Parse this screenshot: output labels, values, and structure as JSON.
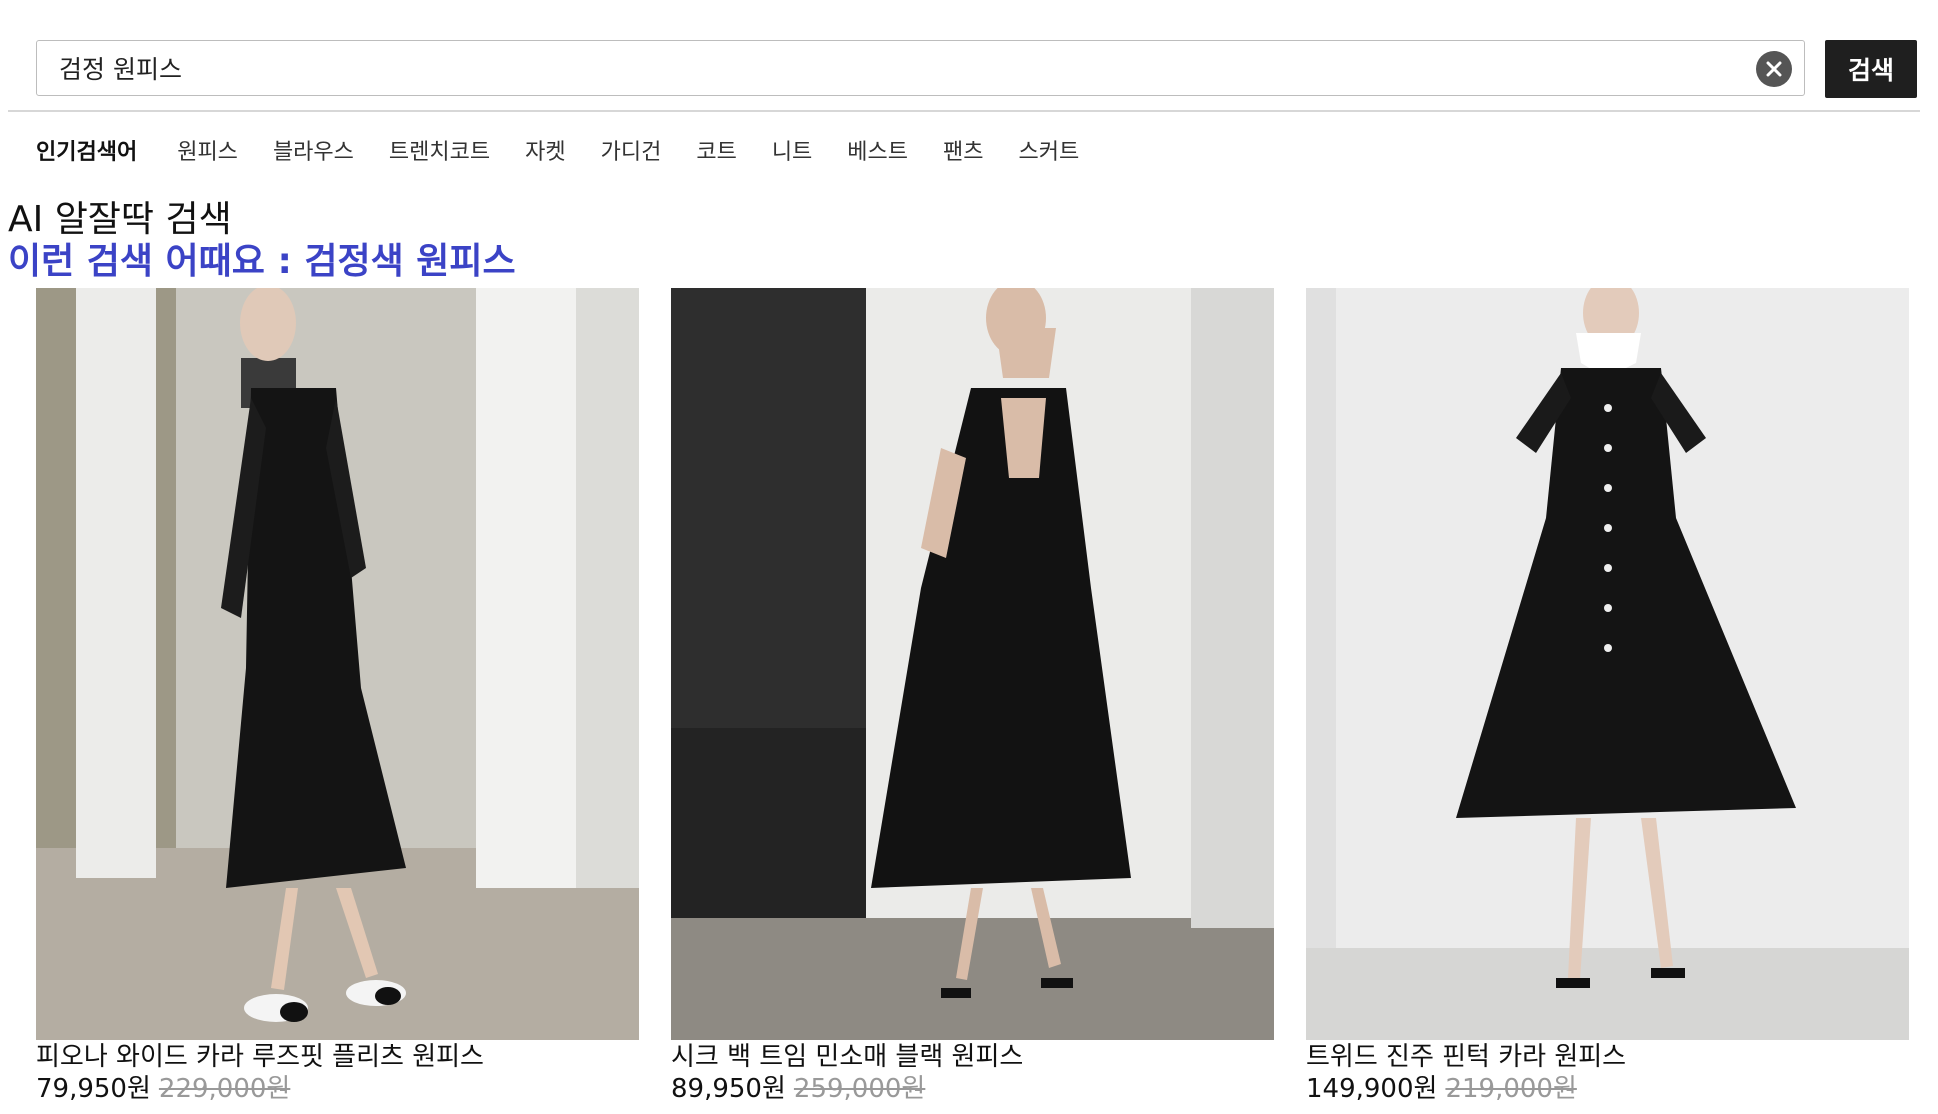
{
  "search": {
    "value": "검정 원피스",
    "button_label": "검색"
  },
  "popular": {
    "label": "인기검색어",
    "items": [
      "원피스",
      "블라우스",
      "트렌치코트",
      "자켓",
      "가디건",
      "코트",
      "니트",
      "베스트",
      "팬츠",
      "스커트"
    ]
  },
  "ai": {
    "title": "AI 알잘딱 검색",
    "suggestion": "이런 검색 어때요 : 검정색 원피스"
  },
  "products": [
    {
      "name": "피오나 와이드 카라 루즈핏 플리츠 원피스",
      "sale_price": "79,950원",
      "original_price": "229,000원"
    },
    {
      "name": "시크 백 트임 민소매 블랙 원피스",
      "sale_price": "89,950원",
      "original_price": "259,000원"
    },
    {
      "name": "트위드 진주 핀턱 카라 원피스",
      "sale_price": "149,900원",
      "original_price": "219,000원"
    }
  ],
  "colors": {
    "accent": "#3b43c6",
    "button_bg": "#1f1f1f",
    "strike": "#999999"
  },
  "icons": {
    "clear": "close-circle-icon"
  }
}
